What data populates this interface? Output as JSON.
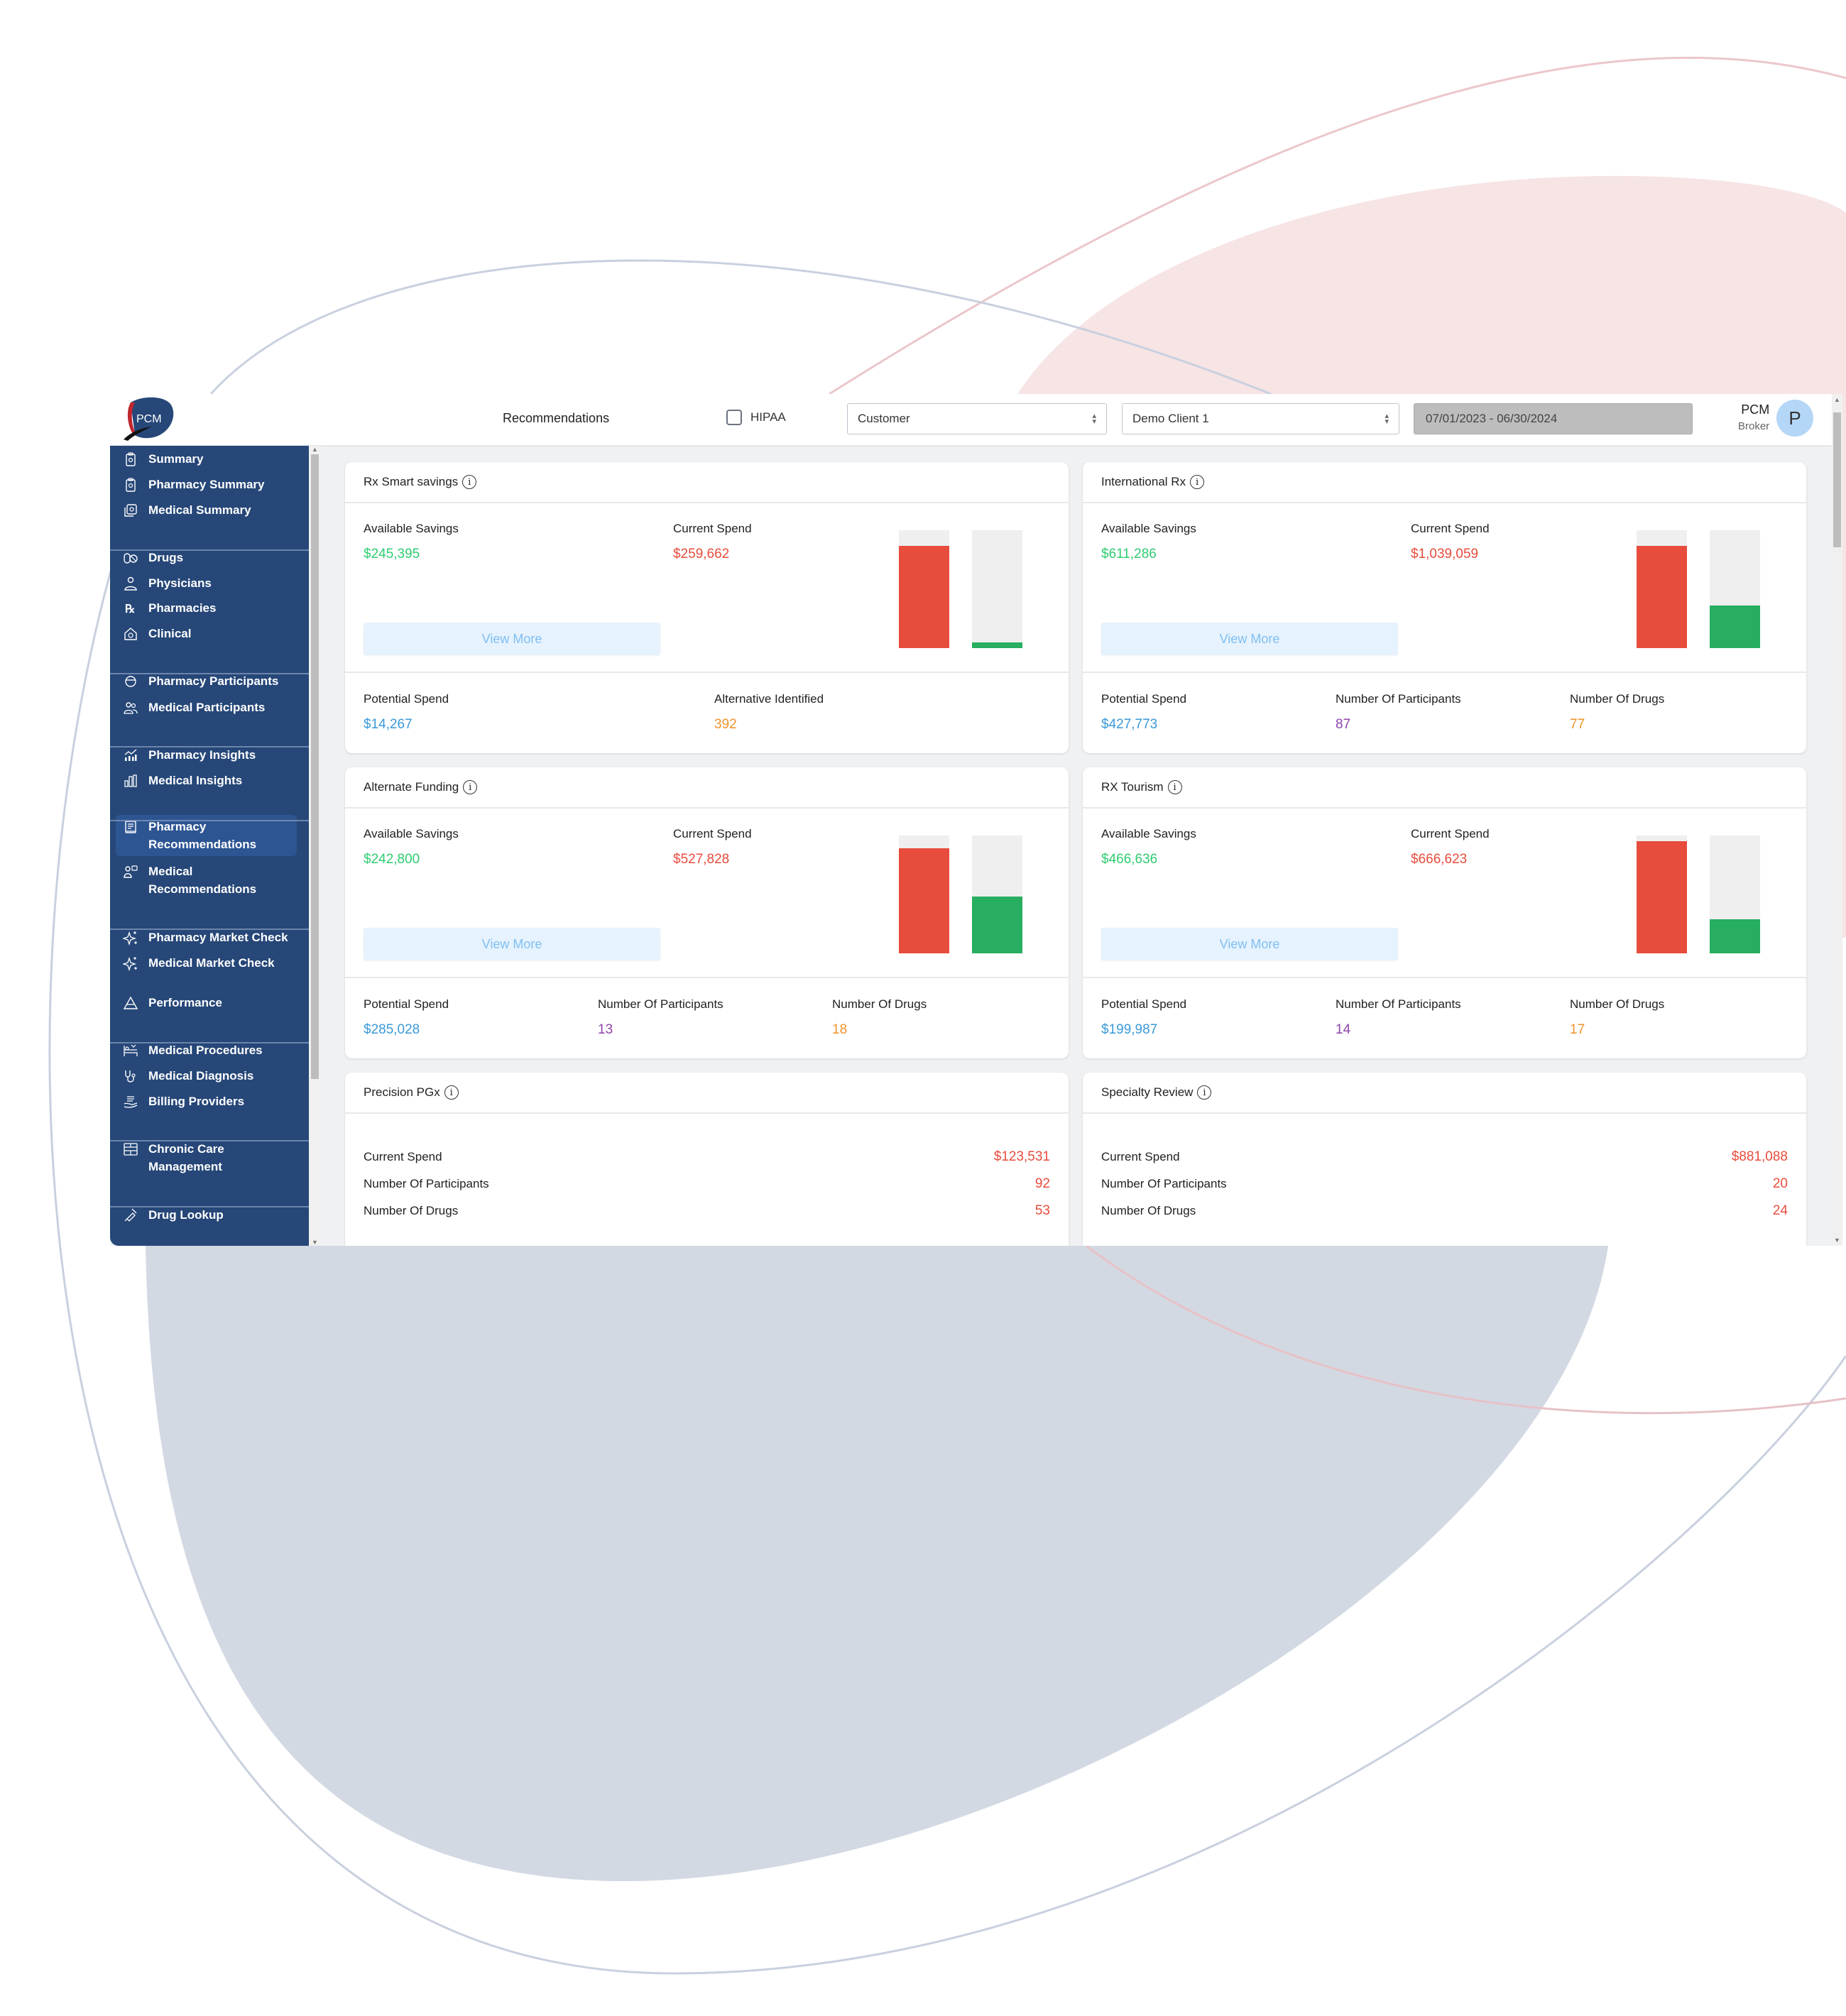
{
  "header": {
    "logo_text": "PCM",
    "page_title": "Recommendations",
    "hipaa_label": "HIPAA",
    "hipaa_checked": false,
    "customer_select": "Customer",
    "client_select": "Demo Client 1",
    "date_range": "07/01/2023 - 06/30/2024",
    "user_name": "PCM",
    "user_role": "Broker",
    "avatar_initial": "P"
  },
  "sidebar": {
    "items": [
      {
        "label": "Summary",
        "icon": "clipboard-icon"
      },
      {
        "label": "Pharmacy Summary",
        "icon": "clipboard-icon"
      },
      {
        "label": "Medical Summary",
        "icon": "medical-stack-icon"
      },
      {
        "label": "Drugs",
        "icon": "pills-icon"
      },
      {
        "label": "Physicians",
        "icon": "physician-icon"
      },
      {
        "label": "Pharmacies",
        "icon": "rx-icon"
      },
      {
        "label": "Clinical",
        "icon": "clinic-icon"
      },
      {
        "label": "Pharmacy Participants",
        "icon": "participant-icon"
      },
      {
        "label": "Medical Participants",
        "icon": "users-icon"
      },
      {
        "label": "Pharmacy Insights",
        "icon": "chart-trend-icon"
      },
      {
        "label": "Medical Insights",
        "icon": "bar-chart-icon"
      },
      {
        "label": "Pharmacy Recommendations",
        "icon": "book-icon",
        "active": true
      },
      {
        "label": "Medical Recommendations",
        "icon": "consult-icon"
      },
      {
        "label": "Pharmacy Market Check",
        "icon": "sparkle-icon"
      },
      {
        "label": "Medical Market Check",
        "icon": "sparkle-icon"
      },
      {
        "label": "Performance",
        "icon": "pyramid-icon"
      },
      {
        "label": "Medical Procedures",
        "icon": "bed-icon"
      },
      {
        "label": "Medical Diagnosis",
        "icon": "stethoscope-icon"
      },
      {
        "label": "Billing Providers",
        "icon": "hand-money-icon"
      },
      {
        "label": "Chronic Care Management",
        "icon": "grid-icon"
      },
      {
        "label": "Drug Lookup",
        "icon": "syringe-icon"
      }
    ]
  },
  "cards": {
    "rx_smart": {
      "title": "Rx Smart savings",
      "available_savings_label": "Available Savings",
      "available_savings": "$245,395",
      "current_spend_label": "Current Spend",
      "current_spend": "$259,662",
      "view_more": "View More",
      "bars": {
        "current_fraction": 0.87,
        "potential_fraction": 0.05
      },
      "footer": [
        {
          "label": "Potential Spend",
          "value": "$14,267"
        },
        {
          "label": "Alternative Identified",
          "value": "392"
        }
      ]
    },
    "international": {
      "title": "International Rx",
      "available_savings_label": "Available Savings",
      "available_savings": "$611,286",
      "current_spend_label": "Current Spend",
      "current_spend": "$1,039,059",
      "view_more": "View More",
      "bars": {
        "current_fraction": 0.87,
        "potential_fraction": 0.36
      },
      "footer": [
        {
          "label": "Potential Spend",
          "value": "$427,773"
        },
        {
          "label": "Number Of Participants",
          "value": "87"
        },
        {
          "label": "Number Of Drugs",
          "value": "77"
        }
      ]
    },
    "alternate_funding": {
      "title": "Alternate Funding",
      "available_savings_label": "Available Savings",
      "available_savings": "$242,800",
      "current_spend_label": "Current Spend",
      "current_spend": "$527,828",
      "view_more": "View More",
      "bars": {
        "current_fraction": 0.89,
        "potential_fraction": 0.48
      },
      "footer": [
        {
          "label": "Potential Spend",
          "value": "$285,028"
        },
        {
          "label": "Number Of Participants",
          "value": "13"
        },
        {
          "label": "Number Of Drugs",
          "value": "18"
        }
      ]
    },
    "rx_tourism": {
      "title": "RX Tourism",
      "available_savings_label": "Available Savings",
      "available_savings": "$466,636",
      "current_spend_label": "Current Spend",
      "current_spend": "$666,623",
      "view_more": "View More",
      "bars": {
        "current_fraction": 0.95,
        "potential_fraction": 0.29
      },
      "footer": [
        {
          "label": "Potential Spend",
          "value": "$199,987"
        },
        {
          "label": "Number Of Participants",
          "value": "14"
        },
        {
          "label": "Number Of Drugs",
          "value": "17"
        }
      ]
    },
    "precision_pgx": {
      "title": "Precision PGx",
      "rows": [
        {
          "label": "Current Spend",
          "value": "$123,531"
        },
        {
          "label": "Number Of Participants",
          "value": "92"
        },
        {
          "label": "Number Of Drugs",
          "value": "53"
        }
      ]
    },
    "specialty_review": {
      "title": "Specialty Review",
      "rows": [
        {
          "label": "Current Spend",
          "value": "$881,088"
        },
        {
          "label": "Number Of Participants",
          "value": "20"
        },
        {
          "label": "Number Of Drugs",
          "value": "24"
        }
      ]
    }
  },
  "colors": {
    "sidebar_bg": "#264778",
    "sidebar_active": "#2d5592",
    "savings_green": "#2ecc71",
    "spend_red": "#e74c3c",
    "potential_blue": "#3a9ad9",
    "orange": "#f0932b",
    "purple": "#8e44ad",
    "bar_red": "#e74c3c",
    "bar_green": "#27ae60"
  }
}
